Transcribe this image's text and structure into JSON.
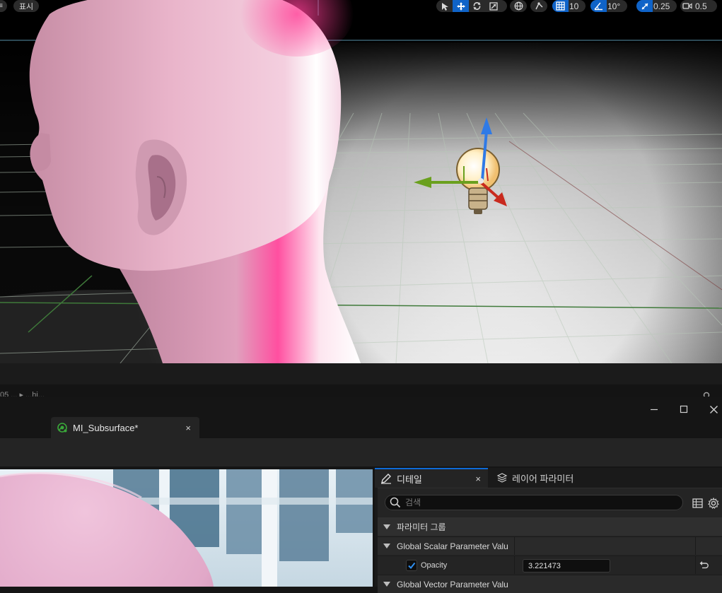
{
  "viewport": {
    "top_left_buttons": {
      "btn1": "",
      "show_label": "표시"
    },
    "toolbar": {
      "grid_snap_value": "10",
      "rotation_snap_value": "10°",
      "scale_snap_value": "0.25",
      "camera_speed_value": "0.5"
    }
  },
  "strip": {
    "text": "05 ... ▸ ...hi..."
  },
  "editor": {
    "document_tab": {
      "label": "MI_Subsurface*",
      "close": "×"
    },
    "window_controls": {
      "minimize": "–",
      "maximize": "□",
      "close": "×"
    },
    "details_panel": {
      "tab_details_label": "디테일",
      "tab_details_close": "×",
      "tab_layer_label": "레이어 파라미터",
      "search_placeholder": "검색",
      "groups": {
        "parameter_group": "파라미터 그룹",
        "global_scalar": "Global Scalar Parameter Valu",
        "opacity_label": "Opacity",
        "opacity_checked": true,
        "opacity_value": "3.221473",
        "global_vector": "Global Vector Parameter Valu"
      }
    }
  },
  "colors": {
    "accent": "#0f63c8",
    "panel_bg": "#242424",
    "header_bg": "#2f2f2f",
    "skin": "#e8b3c8"
  }
}
